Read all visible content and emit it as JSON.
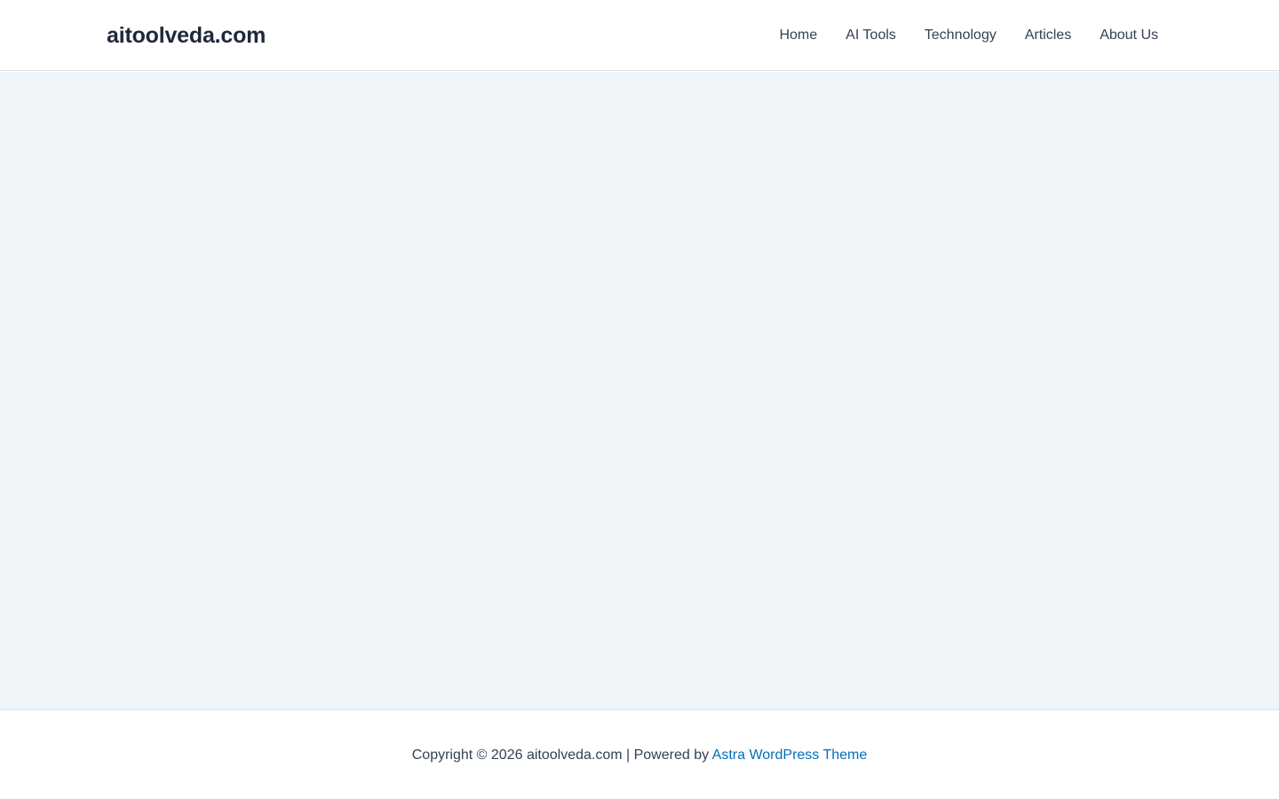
{
  "header": {
    "site_title": "aitoolveda.com",
    "nav": [
      {
        "label": "Home"
      },
      {
        "label": "AI Tools"
      },
      {
        "label": "Technology"
      },
      {
        "label": "Articles"
      },
      {
        "label": "About Us"
      }
    ]
  },
  "footer": {
    "copyright": "Copyright © 2026 aitoolveda.com | Powered by ",
    "theme_link": "Astra WordPress Theme"
  },
  "colors": {
    "content_background": "#eff4f8",
    "link": "#0170b9",
    "title": "#1e293b"
  }
}
